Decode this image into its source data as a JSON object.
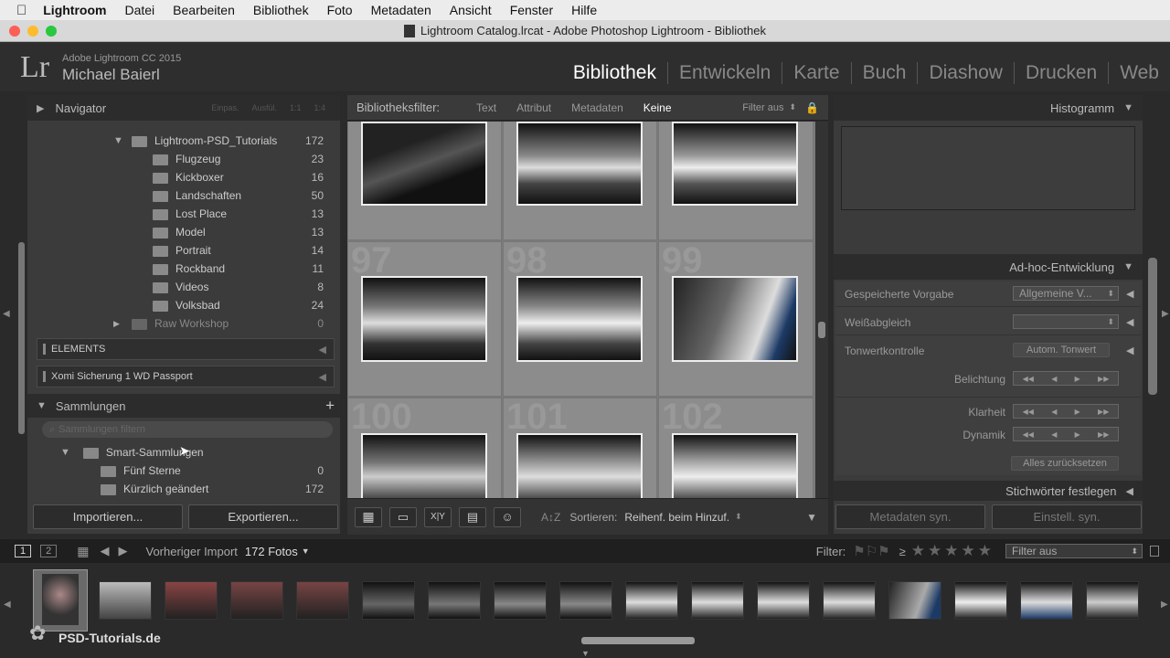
{
  "menubar": {
    "items": [
      "Lightroom",
      "Datei",
      "Bearbeiten",
      "Bibliothek",
      "Foto",
      "Metadaten",
      "Ansicht",
      "Fenster",
      "Hilfe"
    ]
  },
  "window": {
    "title": "Lightroom Catalog.lrcat - Adobe Photoshop Lightroom - Bibliothek"
  },
  "identity": {
    "logo": "Lr",
    "product": "Adobe Lightroom CC 2015",
    "user": "Michael Baierl"
  },
  "modules": [
    "Bibliothek",
    "Entwickeln",
    "Karte",
    "Buch",
    "Diashow",
    "Drucken",
    "Web"
  ],
  "left": {
    "navigator": {
      "title": "Navigator",
      "zoom": [
        "Einpas.",
        "Ausfül.",
        "1:1",
        "1:4"
      ]
    },
    "folders": [
      {
        "name": "Lightroom-PSD_Tutorials",
        "count": "172"
      },
      {
        "name": "Flugzeug",
        "count": "23"
      },
      {
        "name": "Kickboxer",
        "count": "16"
      },
      {
        "name": "Landschaften",
        "count": "50"
      },
      {
        "name": "Lost Place",
        "count": "13"
      },
      {
        "name": "Model",
        "count": "13"
      },
      {
        "name": "Portrait",
        "count": "14"
      },
      {
        "name": "Rockband",
        "count": "11"
      },
      {
        "name": "Videos",
        "count": "8"
      },
      {
        "name": "Volksbad",
        "count": "24"
      },
      {
        "name": "Raw Workshop",
        "count": "0"
      }
    ],
    "volumes": [
      "ELEMENTS",
      "Xomi Sicherung 1 WD Passport"
    ],
    "collections": {
      "title": "Sammlungen",
      "search_placeholder": "Sammlungen filtern",
      "items": [
        {
          "name": "Smart-Sammlungen",
          "count": ""
        },
        {
          "name": "Fünf Sterne",
          "count": "0"
        },
        {
          "name": "Kürzlich geändert",
          "count": "172"
        }
      ]
    },
    "import_label": "Importieren...",
    "export_label": "Exportieren..."
  },
  "filterbar": {
    "label": "Bibliotheksfilter:",
    "options": [
      "Text",
      "Attribut",
      "Metadaten",
      "Keine"
    ],
    "active": "Keine",
    "filter_off": "Filter aus"
  },
  "grid": {
    "row_numbers": [
      "97",
      "98",
      "99",
      "100",
      "101",
      "102"
    ]
  },
  "toolbar": {
    "sort_label": "Sortieren:",
    "sort_value": "Reihenf. beim Hinzuf."
  },
  "right": {
    "histogram": "Histogramm",
    "quick_develop": {
      "title": "Ad-hoc-Entwicklung",
      "preset_label": "Gespeicherte Vorgabe",
      "preset_value": "Allgemeine V...",
      "wb_label": "Weißabgleich",
      "tone_label": "Tonwertkontrolle",
      "auto_tone": "Autom. Tonwert",
      "exposure": "Belichtung",
      "clarity": "Klarheit",
      "vibrance": "Dynamik",
      "reset": "Alles zurücksetzen"
    },
    "keywords": "Stichwörter festlegen",
    "sync_metadata": "Metadaten syn.",
    "sync_settings": "Einstell. syn."
  },
  "filmstrip": {
    "page1": "1",
    "page2": "2",
    "source": "Vorheriger Import",
    "count": "172 Fotos",
    "filter_label": "Filter:",
    "filter_value": "Filter aus",
    "watermark": "PSD-Tutorials.de"
  }
}
